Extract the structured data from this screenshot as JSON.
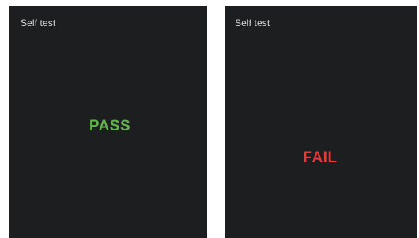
{
  "screens": [
    {
      "title": "Self test",
      "result": "PASS",
      "result_color": "#5fb347"
    },
    {
      "title": "Self test",
      "result": "FAIL",
      "result_color": "#e03a3a"
    }
  ],
  "colors": {
    "screen_background": "#1c1e20",
    "title_text": "#d8d8d8"
  }
}
